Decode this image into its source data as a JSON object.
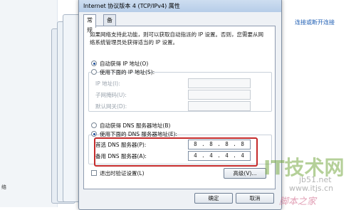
{
  "background": {
    "link_text": "连接或断开连接",
    "left_text": "络"
  },
  "dialog": {
    "title": "Internet 协议版本 4 (TCP/IPv4) 属性",
    "tabs": [
      "常规",
      "备用配置"
    ],
    "description": "如果网络支持此功能，则可以获取自动指派的 IP 设置。否则，您需要从网络系统管理员处获得适当的 IP 设置。",
    "ip": {
      "auto_label": "自动获得 IP 地址(O)",
      "manual_label": "使用下面的 IP 地址(S):",
      "fields": [
        {
          "label": "IP 地址(I):"
        },
        {
          "label": "子网掩码(U):"
        },
        {
          "label": "默认网关(D):"
        }
      ]
    },
    "dns": {
      "auto_label": "自动获得 DNS 服务器地址(B)",
      "manual_label": "使用下面的 DNS 服务器地址(E):",
      "preferred_label": "首选 DNS 服务器(P):",
      "preferred_value": "8 . 8 . 8 . 8",
      "alternate_label": "备用 DNS 服务器(A):",
      "alternate_value": "4 . 4 . 4 . 4"
    },
    "validate_label": "退出时验证设置(L)",
    "advanced_button": "高级(V)...",
    "ok_button": "确定",
    "cancel_button": "取消"
  },
  "watermark": {
    "brand": "IT技术网",
    "site": "www.itjs.cn",
    "site2": "jb51.net",
    "tagline": "脚本之家"
  },
  "colors": {
    "highlight_border": "#c52b2b",
    "link": "#1f5fb4"
  }
}
